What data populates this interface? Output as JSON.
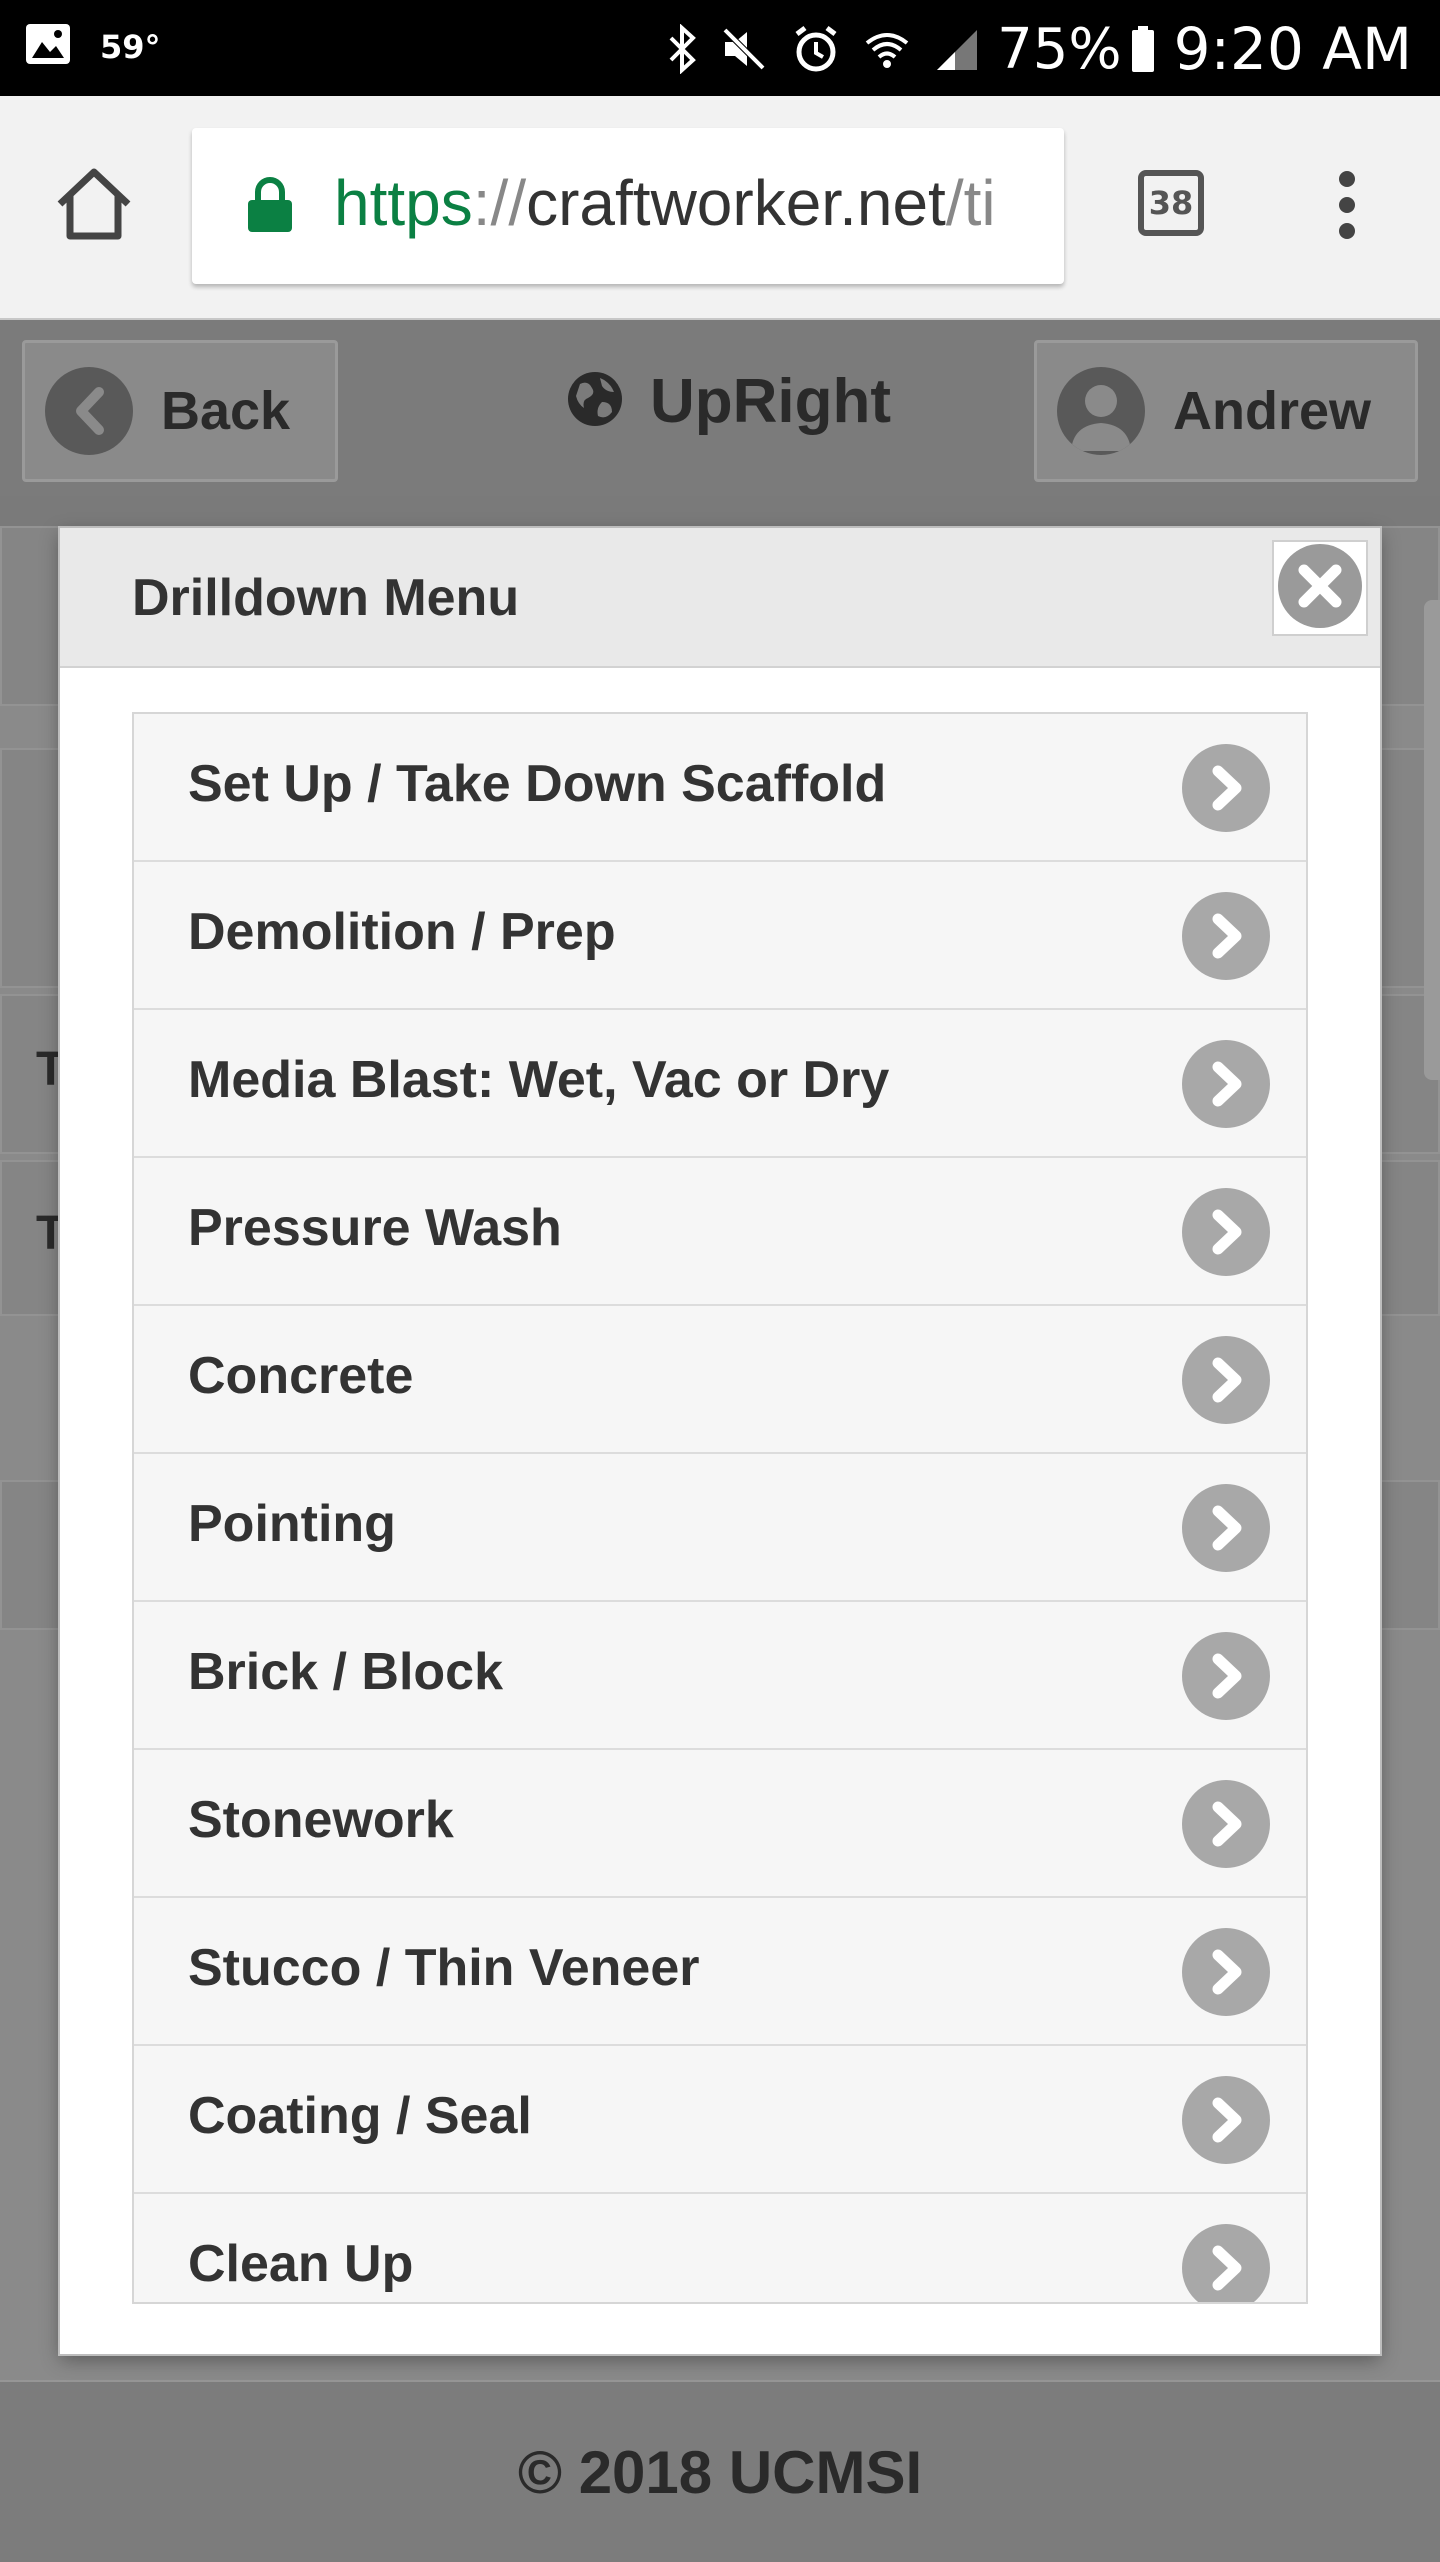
{
  "status_bar": {
    "temperature": "59°",
    "battery": "75%",
    "time": "9:20 AM",
    "icons": [
      "image-icon",
      "bluetooth-icon",
      "mute-icon",
      "alarm-icon",
      "wifi-icon",
      "signal-icon",
      "battery-icon"
    ]
  },
  "browser": {
    "url_scheme": "https",
    "url_sep": "://",
    "url_host": "craftworker.net",
    "url_tail": "/ti",
    "tab_count": "38"
  },
  "header": {
    "back_label": "Back",
    "brand": "UpRight",
    "user_label": "Andrew"
  },
  "background": {
    "row1_letter": "T",
    "row2_letter": "T"
  },
  "modal": {
    "title": "Drilldown Menu",
    "items": [
      {
        "label": "Set Up / Take Down Scaffold"
      },
      {
        "label": "Demolition / Prep"
      },
      {
        "label": "Media Blast: Wet, Vac or Dry"
      },
      {
        "label": "Pressure Wash"
      },
      {
        "label": "Concrete"
      },
      {
        "label": "Pointing"
      },
      {
        "label": "Brick / Block"
      },
      {
        "label": "Stonework"
      },
      {
        "label": "Stucco / Thin Veneer"
      },
      {
        "label": "Coating / Seal"
      },
      {
        "label": "Clean Up"
      }
    ]
  },
  "footer": {
    "copyright": "© 2018 UCMSI"
  }
}
